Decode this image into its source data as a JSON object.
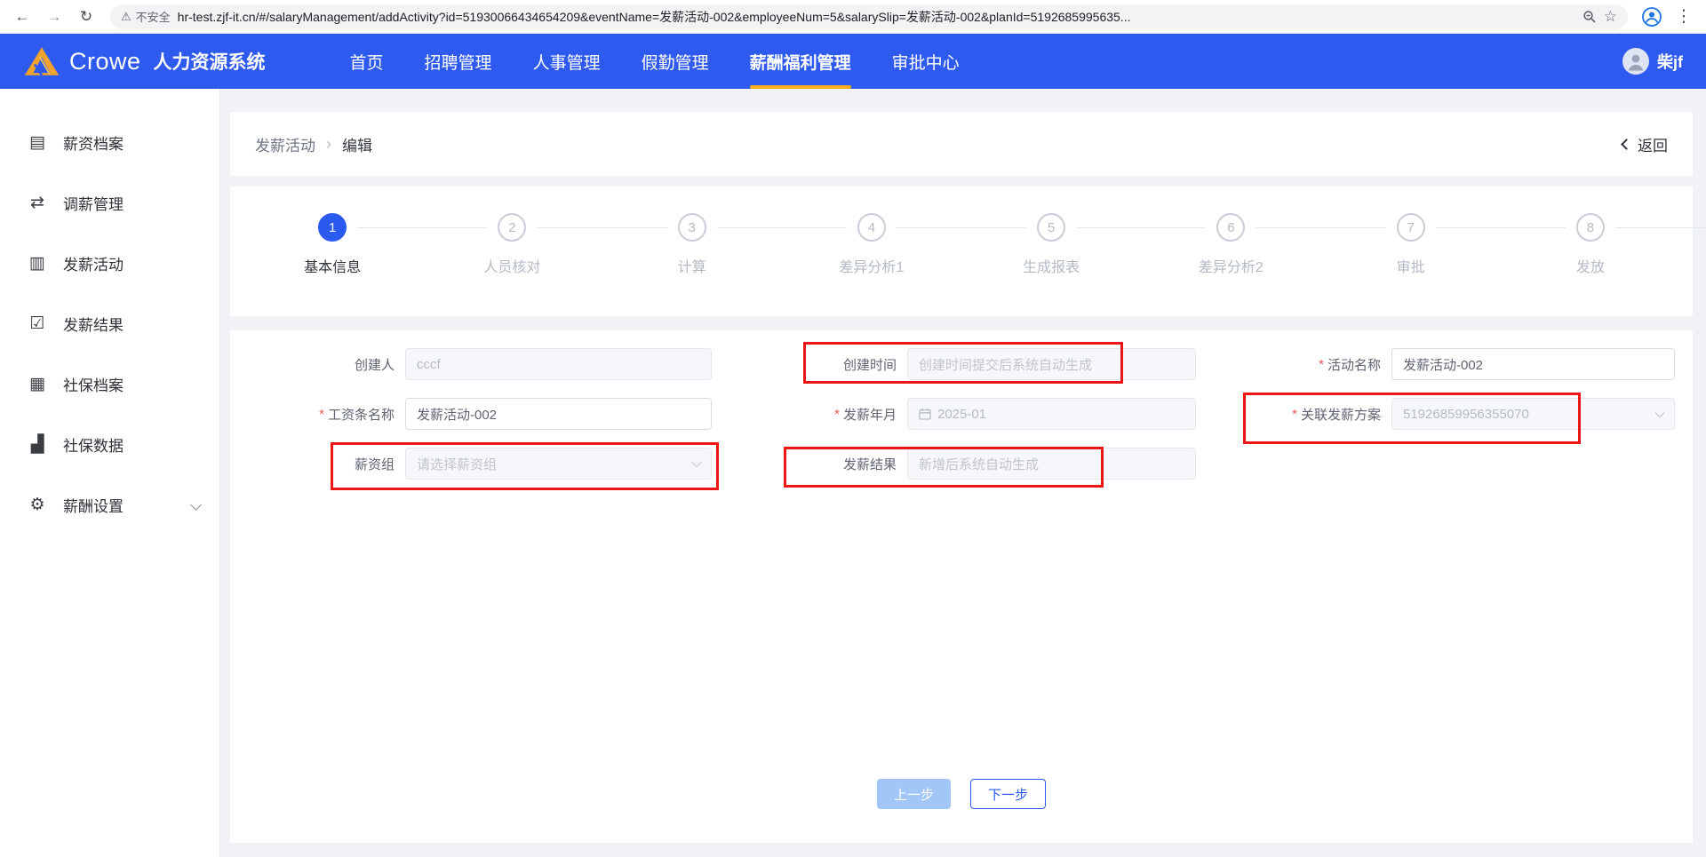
{
  "browser": {
    "back_icon": "←",
    "forward_icon": "→",
    "reload_icon": "↻",
    "warning_icon": "⚠",
    "security_label": "不安全",
    "url": "hr-test.zjf-it.cn/#/salaryManagement/addActivity?id=51930066434654209&eventName=发薪活动-002&employeeNum=5&salarySlip=发薪活动-002&planId=5192685995635...",
    "star_icon": "☆",
    "menu_icon": "⋮"
  },
  "header": {
    "brand": "Crowe",
    "product": "人力资源系统",
    "nav": [
      {
        "label": "首页",
        "state": ""
      },
      {
        "label": "招聘管理",
        "state": ""
      },
      {
        "label": "人事管理",
        "state": ""
      },
      {
        "label": "假勤管理",
        "state": ""
      },
      {
        "label": "薪酬福利管理",
        "state": "active"
      },
      {
        "label": "审批中心",
        "state": ""
      }
    ],
    "user_name": "柴jf"
  },
  "sidebar": {
    "items": [
      {
        "label": "薪资档案",
        "icon": "salary-archive-icon",
        "glyph": "▤",
        "hasChevron": false
      },
      {
        "label": "调薪管理",
        "icon": "salary-adjust-icon",
        "glyph": "⇄",
        "hasChevron": false
      },
      {
        "label": "发薪活动",
        "icon": "payroll-activity-icon",
        "glyph": "▥",
        "hasChevron": false
      },
      {
        "label": "发薪结果",
        "icon": "payroll-result-icon",
        "glyph": "☑",
        "hasChevron": false
      },
      {
        "label": "社保档案",
        "icon": "social-archive-icon",
        "glyph": "▦",
        "hasChevron": false
      },
      {
        "label": "社保数据",
        "icon": "social-data-icon",
        "glyph": "▟",
        "hasChevron": false
      },
      {
        "label": "薪酬设置",
        "icon": "salary-settings-icon",
        "glyph": "⚙",
        "hasChevron": true
      }
    ]
  },
  "breadcrumb": {
    "first": "发薪活动",
    "separator": "›",
    "last": "编辑",
    "back_label": "返回"
  },
  "stepper": {
    "steps": [
      {
        "num": "1",
        "label": "基本信息",
        "state": "active"
      },
      {
        "num": "2",
        "label": "人员核对",
        "state": ""
      },
      {
        "num": "3",
        "label": "计算",
        "state": ""
      },
      {
        "num": "4",
        "label": "差异分析1",
        "state": ""
      },
      {
        "num": "5",
        "label": "生成报表",
        "state": ""
      },
      {
        "num": "6",
        "label": "差异分析2",
        "state": ""
      },
      {
        "num": "7",
        "label": "审批",
        "state": ""
      },
      {
        "num": "8",
        "label": "发放",
        "state": ""
      }
    ]
  },
  "form": {
    "required_mark": "*",
    "fields": [
      {
        "name": "creator-field",
        "label": "创建人",
        "required": false,
        "value": "cccf",
        "placeholder": "",
        "type": "input",
        "stateClass": "disabled",
        "isDate": false,
        "isSelect": false,
        "interactable": "false"
      },
      {
        "name": "create-time-field",
        "label": "创建时间",
        "required": false,
        "value": "",
        "placeholder": "创建时间提交后系统自动生成",
        "type": "input",
        "stateClass": "disabled",
        "isDate": false,
        "isSelect": false,
        "interactable": "false"
      },
      {
        "name": "activity-name-field",
        "label": "活动名称",
        "required": true,
        "value": "发薪活动-002",
        "placeholder": "",
        "type": "input",
        "stateClass": "",
        "isDate": false,
        "isSelect": false,
        "interactable": "true"
      },
      {
        "name": "payslip-name-field",
        "label": "工资条名称",
        "required": true,
        "value": "发薪活动-002",
        "placeholder": "",
        "type": "input",
        "stateClass": "",
        "isDate": false,
        "isSelect": false,
        "interactable": "true"
      },
      {
        "name": "pay-month-field",
        "label": "发薪年月",
        "required": true,
        "value": "2025-01",
        "placeholder": "",
        "type": "date",
        "stateClass": "disabled",
        "isDate": true,
        "isSelect": false,
        "interactable": "false"
      },
      {
        "name": "linked-plan-field",
        "label": "关联发薪方案",
        "required": true,
        "value": "51926859956355070",
        "placeholder": "",
        "type": "select",
        "stateClass": "disabled",
        "isDate": false,
        "isSelect": true,
        "interactable": "false"
      },
      {
        "name": "salary-group-field",
        "label": "薪资组",
        "required": false,
        "value": "",
        "placeholder": "请选择薪资组",
        "type": "select",
        "stateClass": "disabled",
        "isDate": false,
        "isSelect": true,
        "interactable": "false"
      },
      {
        "name": "pay-result-field",
        "label": "发薪结果",
        "required": false,
        "value": "",
        "placeholder": "新增后系统自动生成",
        "type": "input",
        "stateClass": "disabled",
        "isDate": false,
        "isSelect": false,
        "interactable": "false"
      }
    ],
    "prev_label": "上一步",
    "next_label": "下一步"
  },
  "colors": {
    "header_blue": "#2e5af0",
    "accent_blue": "#2b5af1",
    "nav_underline": "#fbae17",
    "annotation_red": "#ed1515",
    "disabled_bg": "#f5f7fa"
  }
}
